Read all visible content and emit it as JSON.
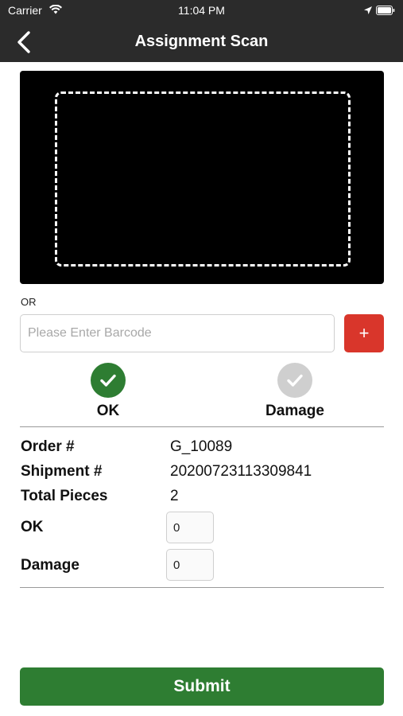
{
  "status_bar": {
    "carrier": "Carrier",
    "time": "11:04 PM",
    "icons": [
      "wifi-icon",
      "location-icon",
      "battery-icon"
    ]
  },
  "nav": {
    "title": "Assignment Scan",
    "back_icon": "chevron-left-icon"
  },
  "scanner": {
    "or_label": "OR"
  },
  "barcode": {
    "value": "",
    "placeholder": "Please Enter Barcode",
    "add_label": "+"
  },
  "condition": {
    "ok_label": "OK",
    "damage_label": "Damage",
    "selected": "OK"
  },
  "details": {
    "order_label": "Order #",
    "order_value": "G_10089",
    "shipment_label": "Shipment #",
    "shipment_value": "20200723113309841",
    "total_pieces_label": "Total Pieces",
    "total_pieces_value": "2",
    "ok_label": "OK",
    "ok_value": "0",
    "damage_label": "Damage",
    "damage_value": "0"
  },
  "submit_label": "Submit",
  "colors": {
    "header": "#2b2b2b",
    "primary_green": "#2e7d32",
    "add_red": "#d9362b",
    "inactive_gray": "#cfcfcf"
  }
}
